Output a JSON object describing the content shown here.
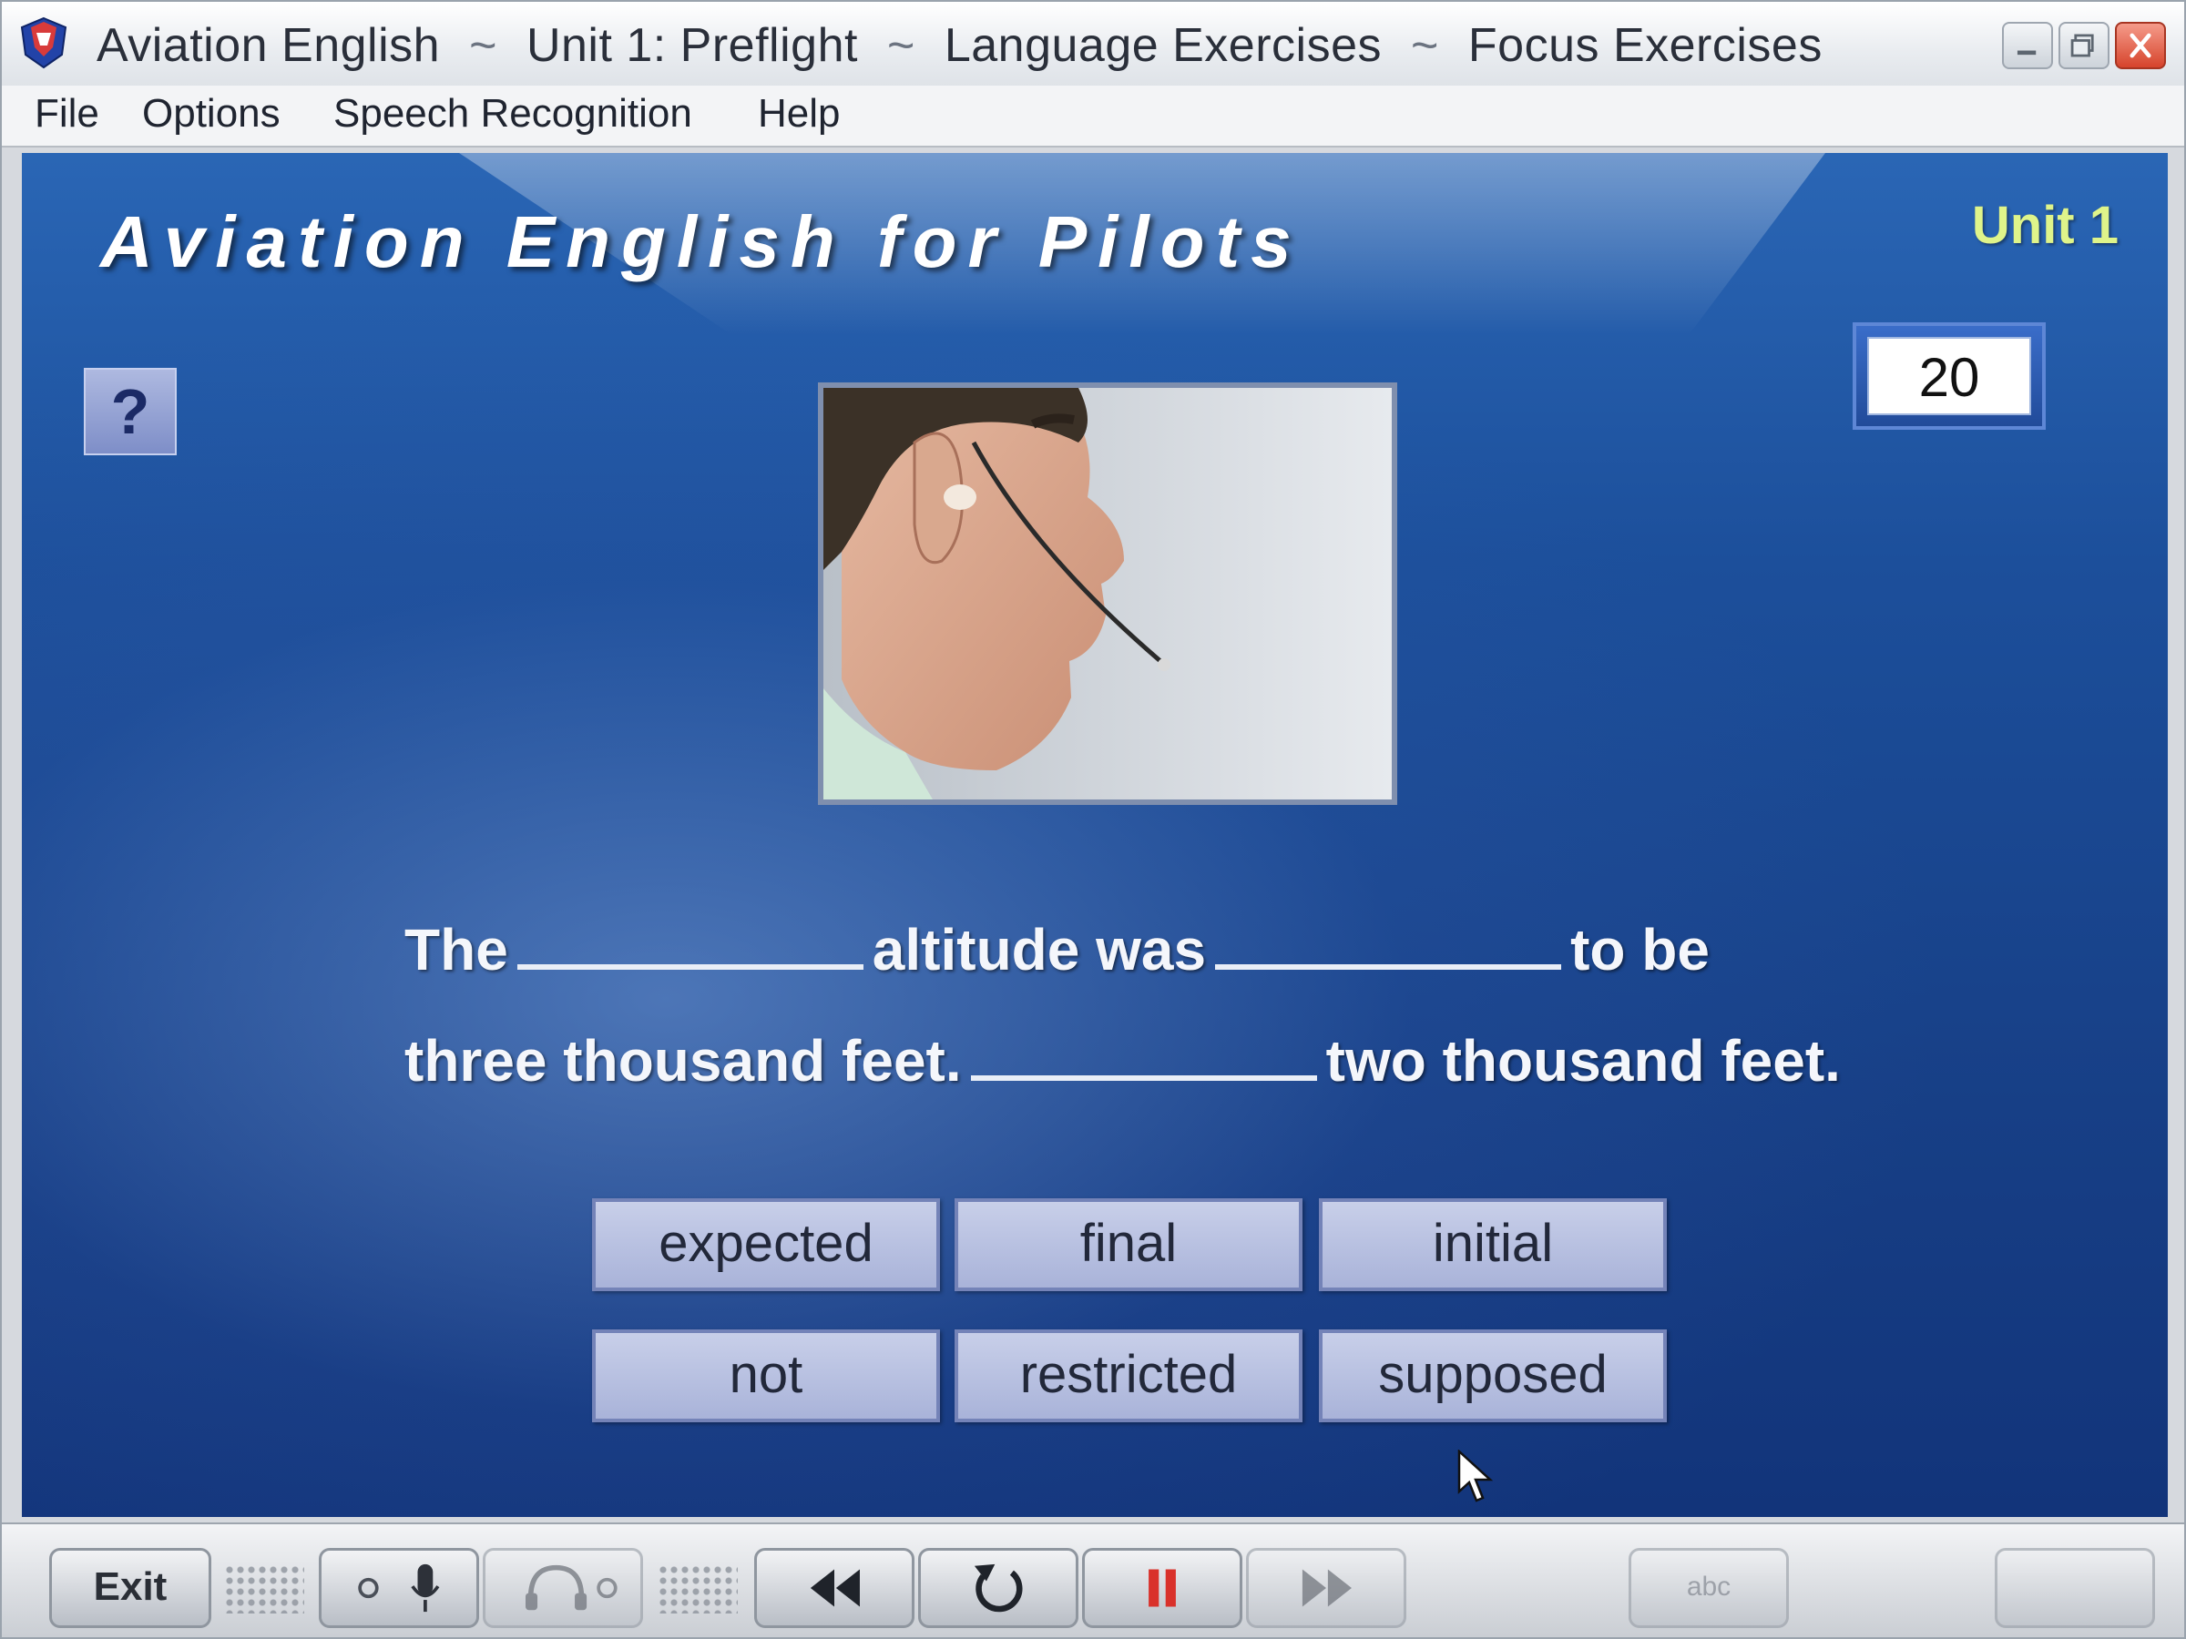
{
  "window": {
    "title_parts": [
      "Aviation English",
      "Unit 1: Preflight",
      "Language Exercises",
      "Focus Exercises"
    ],
    "title_separator": "~"
  },
  "menu": {
    "items": [
      "File",
      "Options",
      "Speech Recognition",
      "Help"
    ]
  },
  "header": {
    "title": "Aviation English for Pilots",
    "unit": "Unit 1"
  },
  "help_button": {
    "label": "?"
  },
  "counter": {
    "value": "20"
  },
  "exercise": {
    "line1": {
      "word1": "The",
      "word2": "altitude was",
      "word3": "to be"
    },
    "line2": {
      "word1": "three thousand feet.",
      "word2": "two thousand feet."
    },
    "choices": [
      "expected",
      "final",
      "initial",
      "not",
      "restricted",
      "supposed"
    ]
  },
  "toolbar": {
    "exit_label": "Exit",
    "abc_label": "abc"
  },
  "colors": {
    "unit_label": "#dff48a",
    "content_bg": "#1c4f9b",
    "choice_bg": "#b8c1e2",
    "pause_red": "#d9312b"
  }
}
